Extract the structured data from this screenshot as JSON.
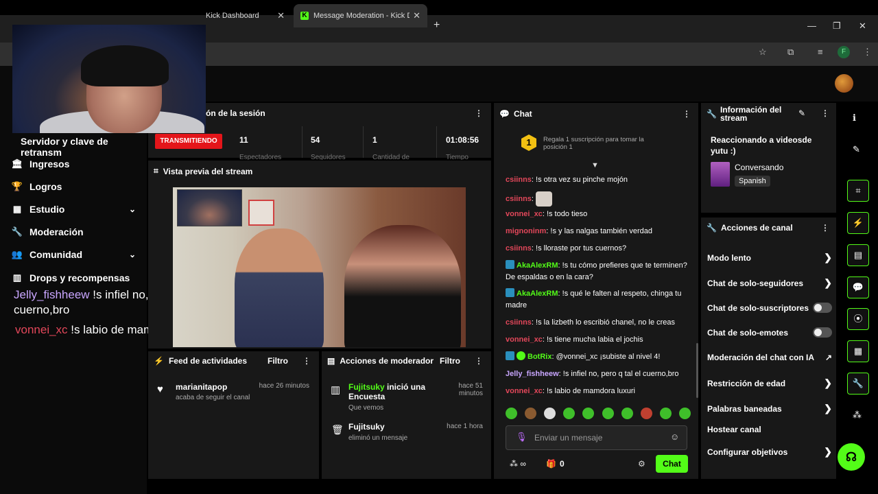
{
  "browser": {
    "tabs": [
      {
        "title": "Kick Dashboard"
      },
      {
        "title": "Message Moderation - Kick Da"
      }
    ],
    "new_tab": "+",
    "profile_letter": "F"
  },
  "nav": {
    "stream_key_label": "Servidor y clave de retransm",
    "items": [
      {
        "label": "Ingresos",
        "icon": "bank-icon"
      },
      {
        "label": "Logros",
        "icon": "trophy-icon"
      },
      {
        "label": "Estudio",
        "icon": "studio-icon"
      },
      {
        "label": "Moderación",
        "icon": "wrench-icon"
      },
      {
        "label": "Comunidad",
        "icon": "people-icon"
      },
      {
        "label": "Drops y recompensas",
        "icon": "chart-icon"
      }
    ]
  },
  "overlay_chat": [
    {
      "user": "Jelly_fishheew",
      "text": "!s infiel no, pero q tal el cuerno,bro",
      "color": "#c9a6ff"
    },
    {
      "user": "vonnei_xc",
      "text": "!s labio de mamdora luxuri",
      "color": "#e3475a"
    }
  ],
  "session": {
    "title": "ón de la sesión",
    "status": "TRANSMITIENDO",
    "stats": [
      {
        "value": "11",
        "label": "Espectadores"
      },
      {
        "value": "54",
        "label": "Seguidores"
      },
      {
        "value": "1",
        "label": "Cantidad de"
      },
      {
        "value": "01:08:56",
        "label": "Tiempo"
      }
    ]
  },
  "preview": {
    "title": "Vista previa del stream"
  },
  "feed": {
    "title": "Feed de actividades",
    "filter": "Filtro",
    "items": [
      {
        "user": "marianitapop",
        "action": "acaba de seguir el canal",
        "time": "hace 26 minutos"
      }
    ]
  },
  "mod_actions": {
    "title": "Acciones de moderador",
    "filter": "Filtro",
    "items": [
      {
        "user": "Fujitsuky",
        "action": " inició una Encuesta",
        "sub": "Que vemos",
        "time": "hace 51 minutos"
      },
      {
        "user": "Fujitsuky",
        "action": "",
        "sub": "eliminó un mensaje",
        "time": "hace 1 hora"
      }
    ]
  },
  "chat": {
    "title": "Chat",
    "pinned": "Regala 1 suscripción para tomar la posición 1",
    "pinned_rank": "1",
    "messages": [
      {
        "user": "csiinns",
        "text": "!s otra vez su pinche mojón",
        "color": "pink"
      },
      {
        "user": "csiinns",
        "text": "",
        "color": "pink",
        "emote": true
      },
      {
        "user": "vonnei_xc",
        "text": "!s todo tieso",
        "color": "pink"
      },
      {
        "user": "mignoninm",
        "text": "!s y las nalgas también verdad",
        "color": "pink"
      },
      {
        "user": "csiinns",
        "text": "!s lloraste por tus cuernos?",
        "color": "pink"
      },
      {
        "user": "AkaAlexRM",
        "text": "!s tu cómo prefieres que te terminen? De espaldas o en la cara?",
        "color": "green",
        "badge": true
      },
      {
        "user": "AkaAlexRM",
        "text": "!s qué le falten al respeto, chinga tu madre",
        "color": "green",
        "badge": true
      },
      {
        "user": "csiinns",
        "text": "!s la lizbeth lo escribió chanel, no le creas",
        "color": "pink"
      },
      {
        "user": "vonnei_xc",
        "text": "!s tiene mucha labia el jochis",
        "color": "pink"
      },
      {
        "user": "BotRix",
        "text": "@vonnei_xc ¡subiste al nivel 4!",
        "color": "green",
        "badge": true
      },
      {
        "user": "Jelly_fishheew",
        "text": "!s infiel no, pero q tal el cuerno,bro",
        "color": "lilac"
      },
      {
        "user": "vonnei_xc",
        "text": "!s labio de mamdora luxuri",
        "color": "pink"
      }
    ],
    "input_placeholder": "Enviar un mensaje",
    "viewer_count": "0",
    "send_label": "Chat"
  },
  "stream_info": {
    "title": "Información del stream",
    "stream_title": "Reaccionando a videosde yutu :)",
    "category": "Conversando",
    "language": "Spanish"
  },
  "channel_actions": {
    "title": "Acciones de canal",
    "items": [
      {
        "label": "Modo lento",
        "control": "arrow"
      },
      {
        "label": "Chat de solo-seguidores",
        "control": "arrow"
      },
      {
        "label": "Chat de solo-suscriptores",
        "control": "toggle"
      },
      {
        "label": "Chat de solo-emotes",
        "control": "toggle"
      },
      {
        "label": "Moderación del chat con IA",
        "control": "external"
      },
      {
        "label": "Restricción de edad",
        "control": "arrow"
      },
      {
        "label": "Palabras baneadas",
        "control": "arrow"
      },
      {
        "label": "Hostear canal",
        "control": "none"
      },
      {
        "label": "Configurar objetivos",
        "control": "arrow"
      }
    ]
  },
  "colors": {
    "accent": "#53fc18",
    "live": "#e4151a",
    "panel": "#181818"
  }
}
